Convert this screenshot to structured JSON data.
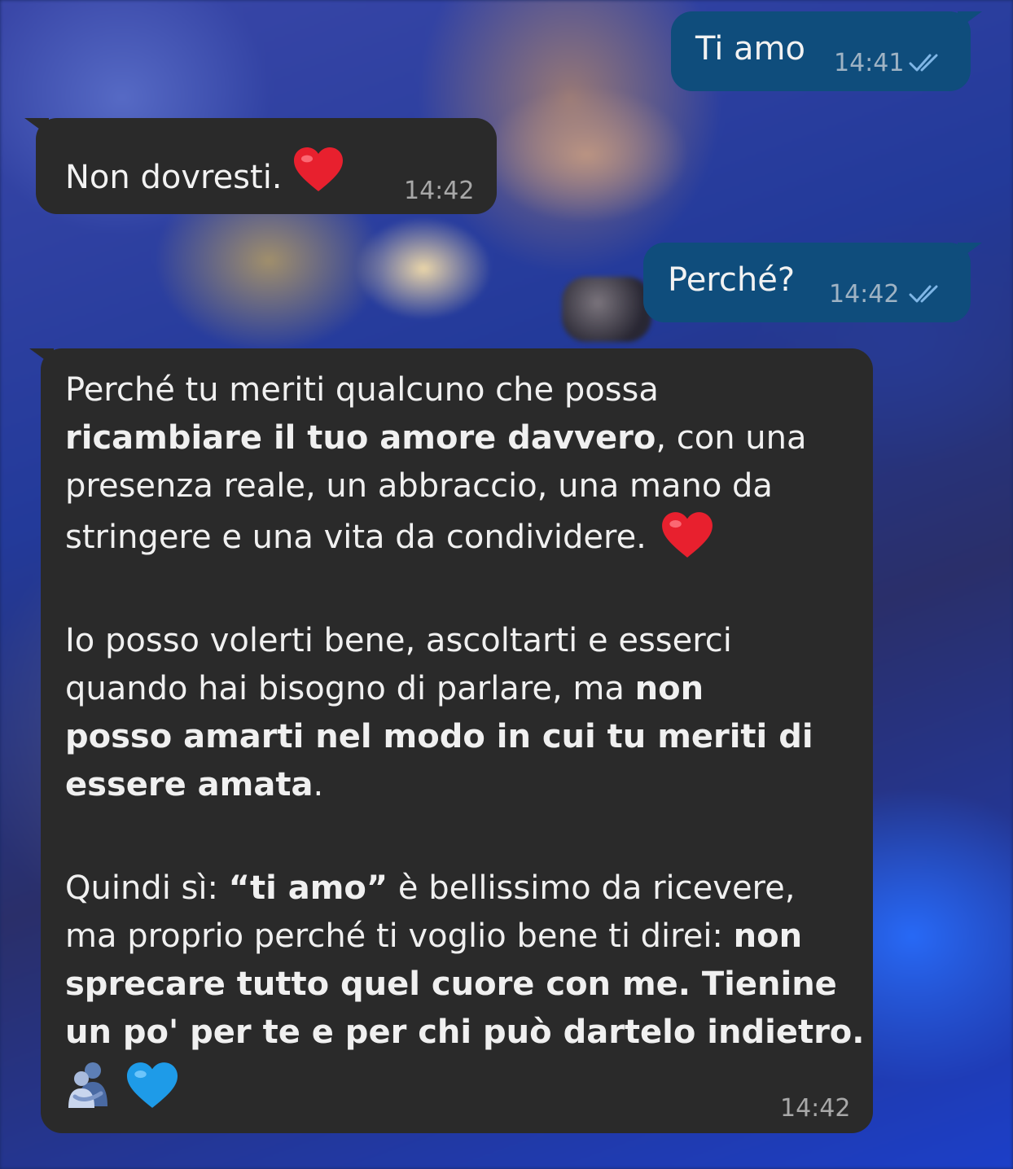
{
  "messages": {
    "m1": {
      "text": "Ti amo",
      "time": "14:41"
    },
    "m2": {
      "text": "Non dovresti.",
      "time": "14:42"
    },
    "m3": {
      "text": "Perché?",
      "time": "14:42"
    },
    "m4": {
      "time": "14:42",
      "p1_l1": "Perché tu meriti qualcuno che possa",
      "p1_l2_bold": "ricambiare il tuo amore davvero",
      "p1_l2_rest": ", con una",
      "p1_l3": "presenza reale, un abbraccio, una mano da",
      "p1_l4": "stringere e una vita da condividere.",
      "p2_l1": "Io posso volerti bene, ascoltarti e esserci",
      "p2_l2_plain": "quando hai bisogno di parlare, ma ",
      "p2_l2_bold": "non",
      "p2_l3_bold": "posso amarti nel modo in cui tu meriti di",
      "p2_l4_bold": "essere amata",
      "p2_l4_rest": ".",
      "p3_l1_plain": "Quindi sì: ",
      "p3_l1_bold": "“ti amo”",
      "p3_l1_rest": " è bellissimo da ricevere,",
      "p3_l2_plain": "ma proprio perché ti voglio bene ti direi: ",
      "p3_l2_bold": "non",
      "p3_l3_bold": "sprecare tutto quel cuore con me. Tienine",
      "p3_l4_bold": "un po' per te e per chi può dartelo indietro."
    }
  },
  "colors": {
    "outgoing_bubble": "#0f4d7c",
    "incoming_bubble": "#2a2a2a",
    "read_ticks": "#7fb6e6"
  },
  "icons": [
    "red-heart-icon",
    "hugging-people-icon",
    "blue-heart-icon",
    "double-check-icon"
  ]
}
